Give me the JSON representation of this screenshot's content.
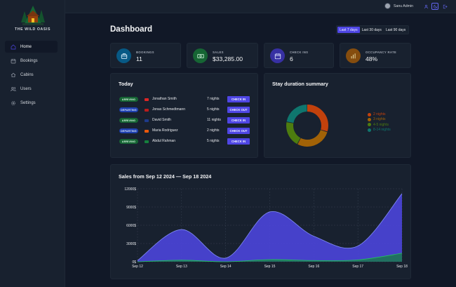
{
  "sidebar": {
    "logo_text": "THE WILD OASIS",
    "items": [
      {
        "label": "Home",
        "icon": "home-icon",
        "active": true
      },
      {
        "label": "Bookings",
        "icon": "calendar-icon",
        "active": false
      },
      {
        "label": "Cabins",
        "icon": "cabin-icon",
        "active": false
      },
      {
        "label": "Users",
        "icon": "users-icon",
        "active": false
      },
      {
        "label": "Settings",
        "icon": "gear-icon",
        "active": false
      }
    ]
  },
  "topbar": {
    "user_name": "Sanu Admin",
    "icons": [
      "user-icon",
      "dark-mode-icon",
      "logout-icon"
    ]
  },
  "page": {
    "title": "Dashboard",
    "filters": [
      {
        "label": "Last 7 days",
        "active": true
      },
      {
        "label": "Last 30 days",
        "active": false
      },
      {
        "label": "Last 90 days",
        "active": false
      }
    ]
  },
  "stats": [
    {
      "label": "BOOKINGS",
      "value": "11",
      "icon": "briefcase-icon",
      "color": "#075985"
    },
    {
      "label": "SALES",
      "value": "$33,285.00",
      "icon": "banknotes-icon",
      "color": "#166534"
    },
    {
      "label": "CHECK INS",
      "value": "6",
      "icon": "calendar-days-icon",
      "color": "#3730a3"
    },
    {
      "label": "OCCUPANCY RATE",
      "value": "48%",
      "icon": "chart-bar-icon",
      "color": "#854d0e"
    }
  ],
  "today": {
    "title": "Today",
    "activities": [
      {
        "status": "ARRIVING",
        "type": "arriving",
        "guest": "Jonathan Smith",
        "nights": "7 nights",
        "action": "CHECK IN",
        "flag_color": "#dc2626"
      },
      {
        "status": "DEPARTING",
        "type": "departing",
        "guest": "Jonas Schmedtmann",
        "nights": "5 nights",
        "action": "CHECK OUT",
        "flag_color": "#b91c1c"
      },
      {
        "status": "ARRIVING",
        "type": "arriving",
        "guest": "David Smith",
        "nights": "11 nights",
        "action": "CHECK IN",
        "flag_color": "#1e3a8a"
      },
      {
        "status": "DEPARTING",
        "type": "departing",
        "guest": "Maria Rodriguez",
        "nights": "2 nights",
        "action": "CHECK OUT",
        "flag_color": "#ea580c"
      },
      {
        "status": "ARRIVING",
        "type": "arriving",
        "guest": "Abdul Rahman",
        "nights": "5 nights",
        "action": "CHECK IN",
        "flag_color": "#15803d"
      }
    ]
  },
  "stay_summary": {
    "title": "Stay duration summary"
  },
  "sales": {
    "title": "Sales from Sep 12 2024 — Sep 18 2024"
  },
  "chart_data": [
    {
      "type": "pie",
      "title": "Stay duration summary",
      "categories": [
        "2 nights",
        "3 nights",
        "4-5 nights",
        "8-14 nights"
      ],
      "values": [
        30,
        28,
        20,
        22
      ],
      "colors": [
        "#c2410c",
        "#a16207",
        "#4d7c0f",
        "#0f766e"
      ],
      "legend": "right"
    },
    {
      "type": "area",
      "title": "Sales from Sep 12 2024 — Sep 18 2024",
      "categories": [
        "Sep 12",
        "Sep 13",
        "Sep 14",
        "Sep 15",
        "Sep 16",
        "Sep 17",
        "Sep 18"
      ],
      "series": [
        {
          "values": [
            200,
            5300,
            600,
            8200,
            4200,
            2600,
            11200
          ],
          "color": "#4f46e5"
        },
        {
          "values": [
            0,
            250,
            0,
            350,
            200,
            300,
            1400
          ],
          "color": "#15803d"
        }
      ],
      "ylim": [
        0,
        12000
      ],
      "yticks": [
        "12000$",
        "9000$",
        "6000$",
        "3000$",
        "0$"
      ],
      "grid": true
    }
  ]
}
